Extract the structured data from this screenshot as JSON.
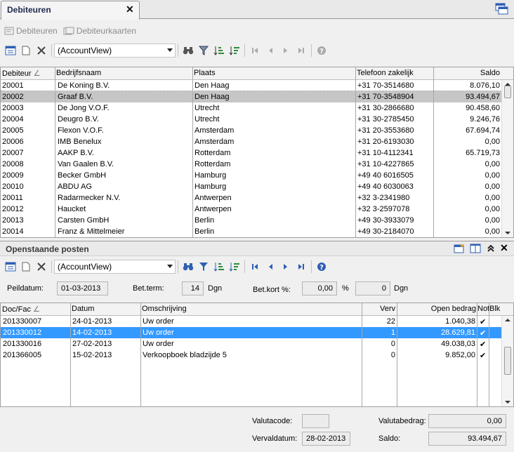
{
  "tab": {
    "title": "Debiteuren",
    "close": "✕"
  },
  "debiteuren": {
    "links": [
      {
        "label": "Debiteuren",
        "icon": "card-icon"
      },
      {
        "label": "Debiteurkaarten",
        "icon": "cards-icon"
      }
    ],
    "combo_value": "(AccountView)",
    "columns": [
      "Debiteur",
      "Bedrijfsnaam",
      "Plaats",
      "Telefoon zakelijk",
      "Saldo"
    ],
    "rows": [
      [
        "20001",
        "De Koning B.V.",
        "Den Haag",
        "+31 70-3514680",
        "8.076,10"
      ],
      [
        "20002",
        "Graaf B.V.",
        "Den Haag",
        "+31 70-3548904",
        "93.494,67"
      ],
      [
        "20003",
        "De Jong V.O.F.",
        "Utrecht",
        "+31 30-2866680",
        "90.458,60"
      ],
      [
        "20004",
        "Deugro B.V.",
        "Utrecht",
        "+31 30-2785450",
        "9.246,76"
      ],
      [
        "20005",
        "Flexon V.O.F.",
        "Amsterdam",
        "+31 20-3553680",
        "67.694,74"
      ],
      [
        "20006",
        "IMB Benelux",
        "Amsterdam",
        "+31 20-6193030",
        "0,00"
      ],
      [
        "20007",
        "AAKP B.V.",
        "Rotterdam",
        "+31 10-4112341",
        "65.719,73"
      ],
      [
        "20008",
        "Van Gaalen B.V.",
        "Rotterdam",
        "+31 10-4227865",
        "0,00"
      ],
      [
        "20009",
        "Becker GmbH",
        "Hamburg",
        "+49 40 6016505",
        "0,00"
      ],
      [
        "20010",
        "ABDU AG",
        "Hamburg",
        "+49 40 6030063",
        "0,00"
      ],
      [
        "20011",
        "Radarmecker N.V.",
        "Antwerpen",
        "+32 3-2341980",
        "0,00"
      ],
      [
        "20012",
        "Haucket",
        "Antwerpen",
        "+32 3-2597078",
        "0,00"
      ],
      [
        "20013",
        "Carsten GmbH",
        "Berlin",
        "+49 30-3933079",
        "0,00"
      ],
      [
        "20014",
        "Franz & Mittelmeier",
        "Berlin",
        "+49 30-2184070",
        "0,00"
      ]
    ],
    "selected_row": 1
  },
  "openstaande": {
    "title": "Openstaande posten",
    "combo_value": "(AccountView)",
    "peildatum_label": "Peildatum:",
    "peildatum_value": "01-03-2013",
    "betterm_label": "Bet.term:",
    "betterm_value": "14",
    "betterm_unit": "Dgn",
    "betkort_label": "Bet.kort %:",
    "betkort_value": "0,00",
    "betkort_unit": "%",
    "betkort_days": "0",
    "betkort_days_unit": "Dgn",
    "columns": [
      "Doc/Fac",
      "Datum",
      "Omschrijving",
      "Verv",
      "Open bedrag",
      "Not",
      "Blk"
    ],
    "rows": [
      [
        "201330007",
        "24-01-2013",
        "Uw order",
        "22",
        "1.040,38",
        "✔",
        ""
      ],
      [
        "201330012",
        "14-02-2013",
        "Uw order",
        "1",
        "28.629,81",
        "✔",
        ""
      ],
      [
        "201330016",
        "27-02-2013",
        "Uw order",
        "0",
        "49.038,03",
        "✔",
        ""
      ],
      [
        "201366005",
        "15-02-2013",
        "Verkoopboek bladzijde 5",
        "0",
        "9.852,00",
        "✔",
        ""
      ]
    ],
    "selected_row": 1,
    "valutacode_label": "Valutacode:",
    "valutacode_value": "",
    "valutabedrag_label": "Valutabedrag:",
    "valutabedrag_value": "0,00",
    "vervaldatum_label": "Vervaldatum:",
    "vervaldatum_value": "28-02-2013",
    "saldo_label": "Saldo:",
    "saldo_value": "93.494,67"
  },
  "colors": {
    "selected_gray": "#c6c6c6",
    "selected_blue": "#3399ff",
    "accent_icon": "#2f5fb3"
  }
}
